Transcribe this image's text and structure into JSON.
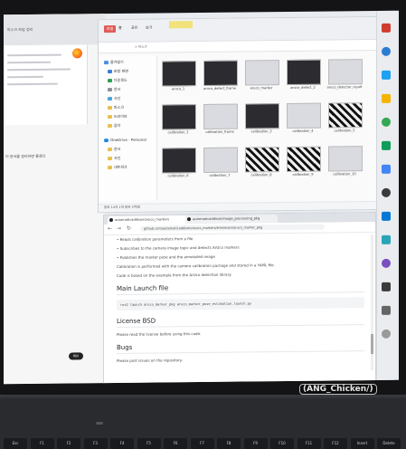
{
  "explorer": {
    "ribbon_tabs": [
      "파일",
      "홈",
      "공유",
      "보기"
    ],
    "address": "> 마스크",
    "nav_items": [
      "즐겨찾기",
      "바탕 화면",
      "다운로드",
      "문서",
      "사진",
      "마스크",
      "드라이브",
      "음악",
      "OneDrive - Personal",
      "문서",
      "사진",
      "네트워크"
    ],
    "status": "항목 14개    1개 항목 선택함",
    "thumbnails": [
      "aruco_1",
      "aruco_detect_frame",
      "aruco_marker",
      "aruco_detect_2",
      "aruco_detector_result",
      "calibration_1",
      "calibration_frame",
      "calibration_3",
      "calibration_4",
      "calibration_5",
      "calibration_6",
      "calibration_7",
      "calibration_8",
      "calibration_9",
      "calibration_10"
    ]
  },
  "browser": {
    "tabs": [
      "automaticaddison/aruco_markers",
      "automaticaddison/image_processing_pkg"
    ],
    "url": "github.com/automaticaddison/aruco_markers/tree/main/aruco_marker_pkg",
    "intro_bullets": [
      "Reads calibration parameters from a file",
      "Subscribes to the camera image topic and detects ArUco markers",
      "Publishes the marker pose and the annotated image"
    ],
    "body_text": [
      "Calibration is performed with the camera calibration package and stored in a YAML file.",
      "Code is based on the example from the ArUco detection library."
    ],
    "section_main": "Main Launch file",
    "launch_code": "ros2 launch aruco_marker_pkg aruco_marker_pose_estimation.launch.py",
    "section_license": "License BSD",
    "license_text": "Please read the license before using this code.",
    "section_bugs": "Bugs",
    "bugs_text": "Please post issues on the repository."
  },
  "left_window": {
    "tab_text": "마스크 파일 정리",
    "body_text": "이 문서를 정리하면 좋겠다",
    "ok_label": "확인"
  },
  "watermark": "(ANG_Chicken/)",
  "keyboard": {
    "keys": [
      "Esc",
      "F1",
      "F2",
      "F3",
      "F4",
      "F5",
      "F6",
      "F7",
      "F8",
      "F9",
      "F10",
      "F11",
      "F12",
      "Insert",
      "Delete"
    ]
  },
  "colors": {
    "explorer_tab_active": "#e05b56",
    "link": "#3b6fc4",
    "taskbar_icons": [
      "#d23b30",
      "#2b7cd3",
      "#1da1f2",
      "#f4b400",
      "#34a853",
      "#0f9d58",
      "#4285f4",
      "#3b3b3b",
      "#0078d4",
      "#2aa5b8",
      "#7a4fc2",
      "#3b3b3b",
      "#666666",
      "#999999"
    ]
  }
}
